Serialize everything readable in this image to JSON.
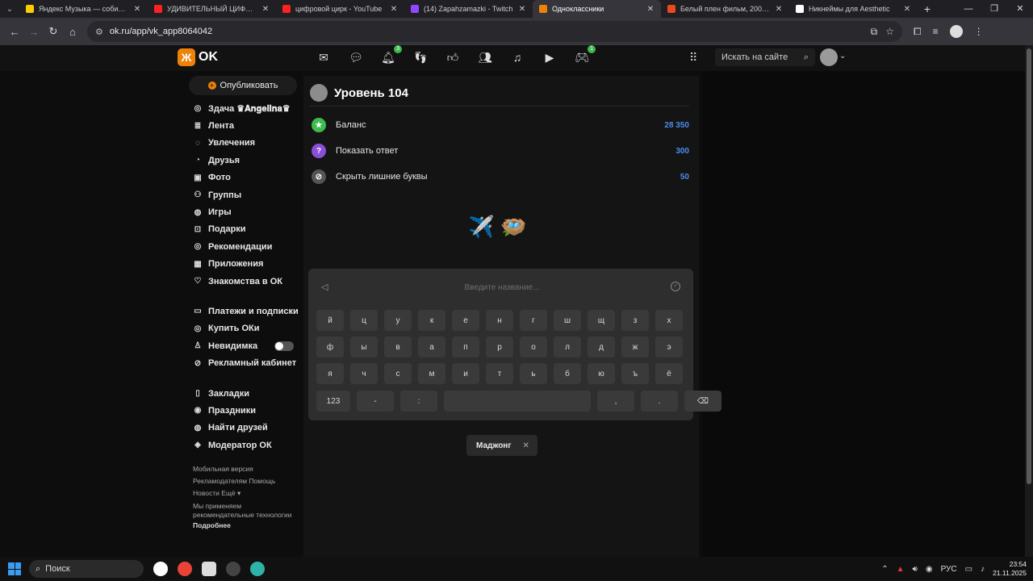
{
  "browser": {
    "tabs": [
      {
        "title": "Яндекс Музыка — собир…",
        "color": "#ffcc00",
        "active": false
      },
      {
        "title": "УДИВИТЕЛЬНЫЙ ЦИФРОВОЙ",
        "color": "#ff2020",
        "active": false
      },
      {
        "title": "цифровой цирк - YouTube",
        "color": "#ff2020",
        "active": false
      },
      {
        "title": "(14) Zapahzamazki - Twitch",
        "color": "#9146ff",
        "active": false
      },
      {
        "title": "Одноклассники",
        "color": "#ee8208",
        "active": true
      },
      {
        "title": "Белый плен фильм, 2005, дата",
        "color": "#e84a1c",
        "active": false
      },
      {
        "title": "Никнеймы для Aesthetic",
        "color": "#ffffff",
        "active": false
      }
    ],
    "url": "ok.ru/app/vk_app8064042"
  },
  "ok_header": {
    "logo_text": "OK",
    "search_placeholder": "Искать на сайте",
    "notifications_badge": "3",
    "games_badge": "1"
  },
  "sidebar": {
    "publish_label": "Опубликовать",
    "profile_name": "Здача ♛𝐀𝐧𝐠𝐞𝐥𝐢𝐧𝐚♛",
    "items_main": [
      "Лента",
      "Увлечения",
      "Друзья",
      "Фото",
      "Группы",
      "Игры",
      "Подарки",
      "Рекомендации",
      "Приложения",
      "Знакомства в ОК"
    ],
    "items_second": [
      "Платежи и подписки",
      "Купить ОКи",
      "Невидимка",
      "Рекламный кабинет"
    ],
    "items_third": [
      "Закладки",
      "Праздники",
      "Найти друзей",
      "Модератор ОК"
    ],
    "footer": {
      "mobile": "Мобильная версия",
      "advertisers": "Рекламодателям",
      "help": "Помощь",
      "news": "Новости",
      "more": "Ещё ▾",
      "tech_note": "Мы применяем рекомендательные технологии",
      "details": "Подробнее"
    }
  },
  "game": {
    "level_title": "Уровень 104",
    "bonuses": [
      {
        "label": "Баланс",
        "value": "28 350",
        "icon": "star-icon",
        "color": "#3dbb4c"
      },
      {
        "label": "Показать ответ",
        "value": "300",
        "icon": "question-icon",
        "color": "#8a4fd8"
      },
      {
        "label": "Скрыть лишние буквы",
        "value": "50",
        "icon": "eye-off-icon",
        "color": "#555555"
      }
    ],
    "emojis": [
      "✈️",
      "🪺"
    ],
    "input_placeholder": "Введите название...",
    "keyboard": [
      [
        "й",
        "ц",
        "у",
        "к",
        "е",
        "н",
        "г",
        "ш",
        "щ",
        "з",
        "х"
      ],
      [
        "ф",
        "ы",
        "в",
        "а",
        "п",
        "р",
        "о",
        "л",
        "д",
        "ж",
        "э"
      ],
      [
        "я",
        "ч",
        "с",
        "м",
        "и",
        "т",
        "ь",
        "б",
        "ю",
        "ъ",
        "ё"
      ]
    ],
    "bottom_row": {
      "numbers": "123",
      "dash": "-",
      "colon": ":",
      "comma": ",",
      "dot": ".",
      "backspace": "⌫"
    },
    "chip_label": "Маджонг"
  },
  "taskbar": {
    "search_label": "Поиск",
    "lang": "РУС",
    "time": "23:54",
    "date": "21.11.2025"
  }
}
